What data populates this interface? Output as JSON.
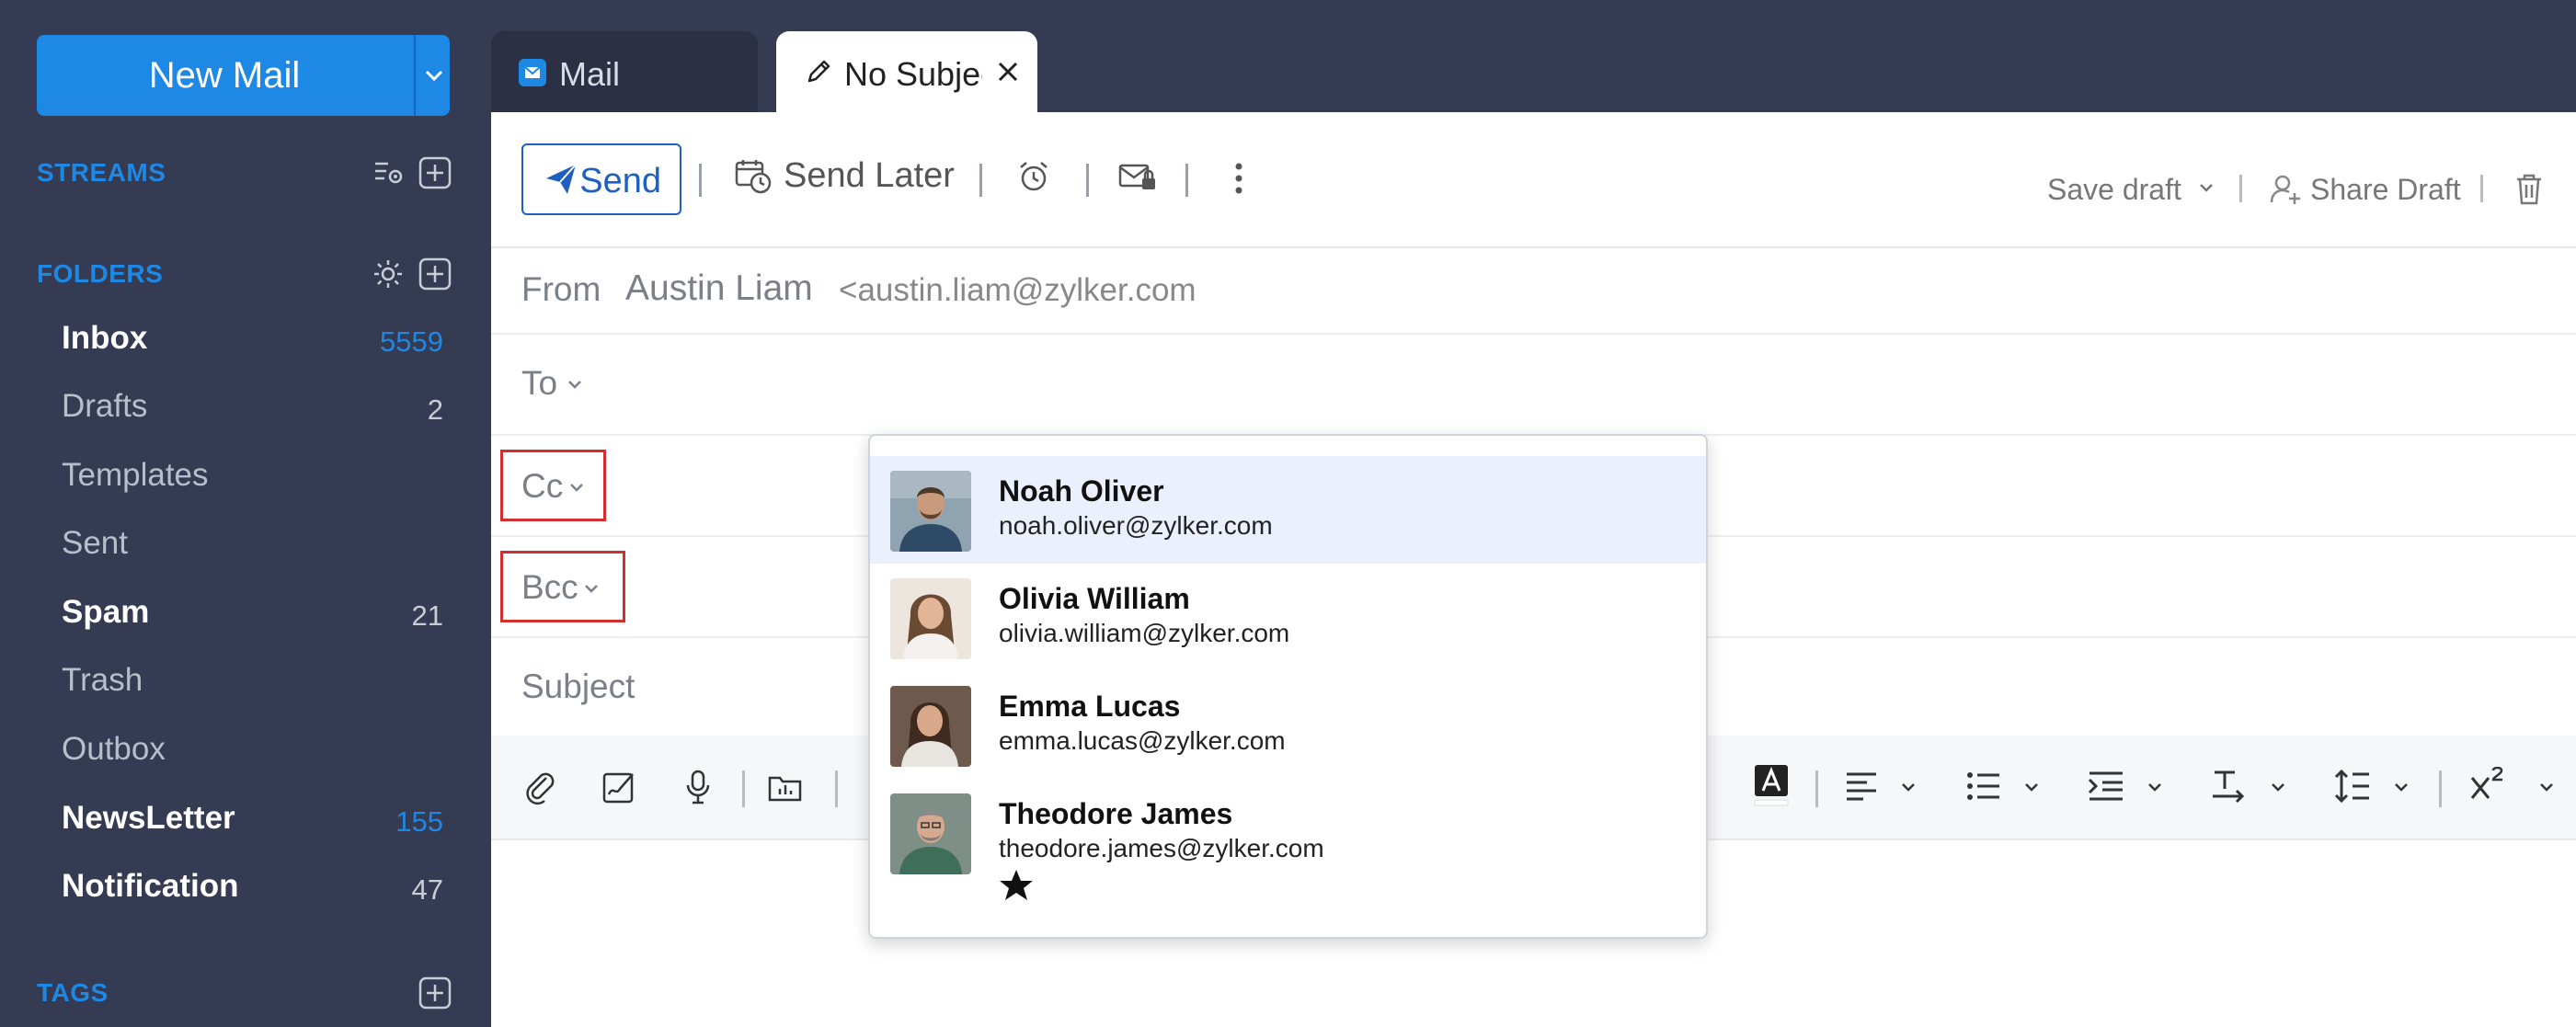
{
  "sidebar": {
    "new_mail_label": "New Mail",
    "streams_title": "STREAMS",
    "folders_title": "FOLDERS",
    "tags_title": "TAGS",
    "folders": [
      {
        "label": "Inbox",
        "count": "5559"
      },
      {
        "label": "Drafts",
        "count": "2"
      },
      {
        "label": "Templates",
        "count": ""
      },
      {
        "label": "Sent",
        "count": ""
      },
      {
        "label": "Spam",
        "count": "21"
      },
      {
        "label": "Trash",
        "count": ""
      },
      {
        "label": "Outbox",
        "count": ""
      },
      {
        "label": "NewsLetter",
        "count": "155"
      },
      {
        "label": "Notification",
        "count": "47"
      }
    ]
  },
  "tabs": {
    "mail_label": "Mail",
    "compose_label": "No Subject"
  },
  "toolbar": {
    "send_label": "Send",
    "send_later_label": "Send Later",
    "save_draft_label": "Save draft",
    "share_draft_label": "Share Draft"
  },
  "compose": {
    "from_label": "From",
    "from_name": "Austin Liam",
    "from_email": "<austin.liam@zylker.com",
    "to_label": "To",
    "cc_label": "Cc",
    "bcc_label": "Bcc",
    "subject_label": "Subject"
  },
  "suggestions": [
    {
      "name": "Noah Oliver",
      "email": "noah.oliver@zylker.com"
    },
    {
      "name": "Olivia William",
      "email": "olivia.william@zylker.com"
    },
    {
      "name": "Emma Lucas",
      "email": "emma.lucas@zylker.com"
    },
    {
      "name": "Theodore James",
      "email": "theodore.james@zylker.com"
    }
  ],
  "colors": {
    "accent": "#1e88e5",
    "sidebar_bg": "#353b52",
    "highlight": "#eaf1fd",
    "annotation_red": "#d32f2f"
  }
}
